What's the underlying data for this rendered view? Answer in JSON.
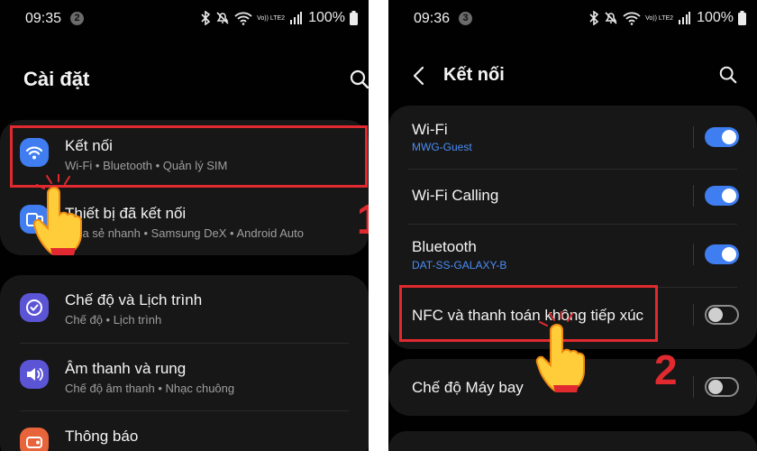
{
  "left_screen": {
    "status_bar": {
      "time": "09:35",
      "notification_count": "2",
      "signal_label": "Vo)) LTE2",
      "battery": "100%"
    },
    "title": "Cài đặt",
    "card1": [
      {
        "title": "Kết nối",
        "subtitle": "Wi-Fi • Bluetooth • Quản lý SIM",
        "icon": "wifi-icon",
        "color": "#3f7df0"
      },
      {
        "title": "Thiết bị đã kết nối",
        "subtitle": "Chia sẻ nhanh • Samsung DeX • Android Auto",
        "icon": "connected-devices-icon",
        "color": "#3f7df0"
      }
    ],
    "card2": [
      {
        "title": "Chế độ và Lịch trình",
        "subtitle": "Chế độ • Lịch trình",
        "icon": "modes-icon",
        "color": "#5b55d6"
      },
      {
        "title": "Âm thanh và rung",
        "subtitle": "Chế độ âm thanh • Nhạc chuông",
        "icon": "sound-icon",
        "color": "#5b55d6"
      },
      {
        "title": "Thông báo",
        "subtitle": "",
        "icon": "notification-icon",
        "color": "#e8643a"
      }
    ],
    "step_number": "1"
  },
  "right_screen": {
    "status_bar": {
      "time": "09:36",
      "notification_count": "3",
      "signal_label": "Vo)) LTE2",
      "battery": "100%"
    },
    "title": "Kết nối",
    "card1": [
      {
        "title": "Wi-Fi",
        "subtitle": "MWG-Guest",
        "toggle": "on"
      },
      {
        "title": "Wi-Fi Calling",
        "subtitle": "",
        "toggle": "on"
      },
      {
        "title": "Bluetooth",
        "subtitle": "DAT-SS-GALAXY-B",
        "toggle": "on"
      },
      {
        "title": "NFC và thanh toán không tiếp xúc",
        "subtitle": "",
        "toggle": "off"
      }
    ],
    "card2": [
      {
        "title": "Chế độ Máy bay",
        "subtitle": "",
        "toggle": "off"
      }
    ],
    "step_number": "2"
  },
  "colors": {
    "accent": "#3e7ef1",
    "highlight": "#e02a2f",
    "card_bg": "#171717",
    "screen_bg": "#010101"
  }
}
